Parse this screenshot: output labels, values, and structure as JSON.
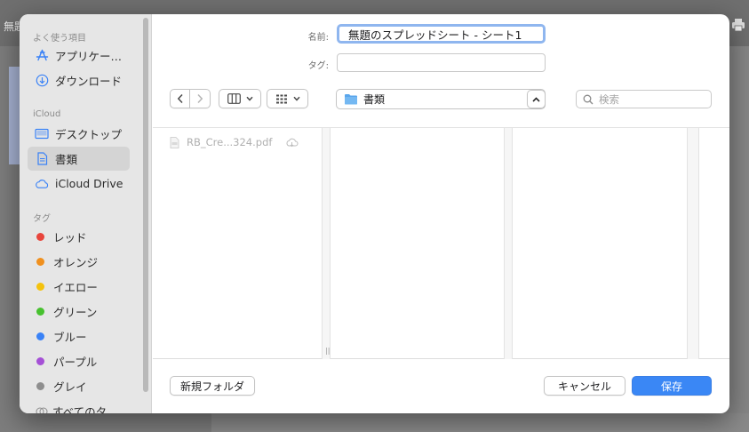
{
  "background_app": {
    "title_fragment": "無題"
  },
  "sidebar": {
    "favorites_header": "よく使う項目",
    "favorites": [
      {
        "label": "アプリケー…",
        "icon": "applications-icon"
      },
      {
        "label": "ダウンロード",
        "icon": "downloads-icon"
      }
    ],
    "icloud_header": "iCloud",
    "icloud": [
      {
        "label": "デスクトップ",
        "icon": "desktop-icon"
      },
      {
        "label": "書類",
        "icon": "document-icon",
        "selected": true
      },
      {
        "label": "iCloud Drive",
        "icon": "cloud-icon"
      }
    ],
    "tags_header": "タグ",
    "tags": [
      {
        "label": "レッド",
        "color": "#e8453c"
      },
      {
        "label": "オレンジ",
        "color": "#f0901e"
      },
      {
        "label": "イエロー",
        "color": "#f4c20d"
      },
      {
        "label": "グリーン",
        "color": "#47c12f"
      },
      {
        "label": "ブルー",
        "color": "#3a82f6"
      },
      {
        "label": "パープル",
        "color": "#a550d6"
      },
      {
        "label": "グレイ",
        "color": "#8e8e8e"
      },
      {
        "label": "すべてのタ…",
        "color": ""
      }
    ]
  },
  "form": {
    "name_label": "名前:",
    "name_value": "無題のスプレッドシート - シート1",
    "tag_label": "タグ:",
    "tag_value": ""
  },
  "toolbar": {
    "location": "書類",
    "search_placeholder": "検索"
  },
  "browser": {
    "files": [
      {
        "name": "RB_Cre...324.pdf",
        "in_cloud": true
      }
    ]
  },
  "buttons": {
    "new_folder": "新規フォルダ",
    "cancel": "キャンセル",
    "save": "保存"
  },
  "colors": {
    "accent": "#3a87f5",
    "sidebar_bg": "#e6e6e6",
    "selected_bg": "#d4d4d4"
  }
}
